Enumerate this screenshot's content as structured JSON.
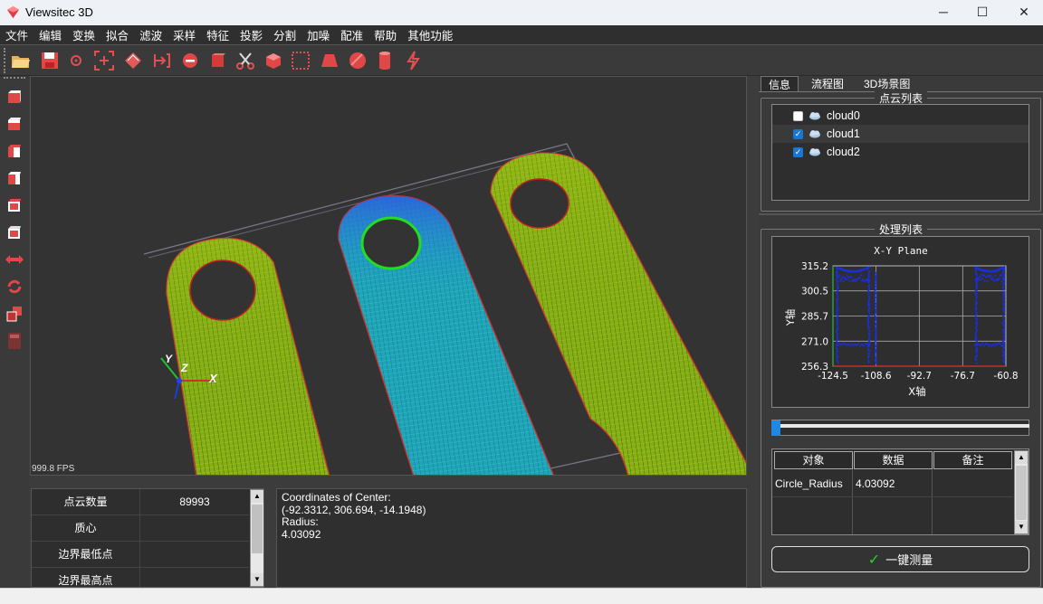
{
  "window": {
    "title": "Viewsitec 3D",
    "minimize_icon": "─",
    "maximize_icon": "☐",
    "close_icon": "✕"
  },
  "menu": [
    "文件",
    "编辑",
    "变换",
    "拟合",
    "滤波",
    "采样",
    "特征",
    "投影",
    "分割",
    "加噪",
    "配准",
    "帮助",
    "其他功能"
  ],
  "toolbar_icons": [
    "open-folder-icon",
    "save-icon",
    "point-icon",
    "select-point-icon",
    "fit-plane-icon",
    "measure-icon",
    "circle-minus-icon",
    "cube-red-icon",
    "scissors-icon",
    "box-icon",
    "box-select-icon",
    "frustum-icon",
    "sphere-icon",
    "cylinder-icon",
    "lightning-icon"
  ],
  "left_toolbar_icons": [
    "view-front-icon",
    "view-back-icon",
    "view-left-icon",
    "view-right-icon",
    "view-top-icon",
    "view-bottom-icon",
    "translate-arrows-icon",
    "rotate-icon",
    "scale-icon",
    "calculator-icon"
  ],
  "viewport": {
    "fps": "999.8 FPS",
    "axis_x": "X",
    "axis_y": "Y",
    "axis_z": "Z"
  },
  "properties": {
    "rows": [
      {
        "key": "点云数量",
        "value": "89993"
      },
      {
        "key": "质心",
        "value": ""
      },
      {
        "key": "边界最低点",
        "value": ""
      },
      {
        "key": "边界最高点",
        "value": ""
      }
    ]
  },
  "coords_panel": {
    "line1": "Coordinates of Center:",
    "line2": "(-92.3312, 306.694, -14.1948)",
    "line3": "Radius:",
    "line4": "4.03092"
  },
  "right_tabs": [
    "信息",
    "流程图",
    "3D场景图"
  ],
  "cloud_list": {
    "title": "点云列表",
    "items": [
      {
        "label": "cloud0",
        "checked": false
      },
      {
        "label": "cloud1",
        "checked": true
      },
      {
        "label": "cloud2",
        "checked": true
      }
    ]
  },
  "process_list": {
    "title": "处理列表"
  },
  "chart_data": {
    "type": "scatter",
    "title": "X-Y Plane",
    "xlabel": "X轴",
    "ylabel": "Y轴",
    "xticks": [
      "-124.5",
      "-108.6",
      "-92.7",
      "-76.7",
      "-60.8"
    ],
    "yticks": [
      "315.2",
      "300.5",
      "285.7",
      "271.0",
      "256.3"
    ],
    "xlim": [
      -124.5,
      -60.8
    ],
    "ylim": [
      256.3,
      315.2
    ],
    "grid": true,
    "series_color": "#1a2fe0"
  },
  "data_table": {
    "headers": [
      "对象",
      "数据",
      "备注"
    ],
    "rows": [
      [
        "Circle_Radius",
        "4.03092",
        ""
      ]
    ]
  },
  "measure_button": {
    "label": "一键测量",
    "icon": "✓"
  },
  "colors": {
    "accent_blue": "#1976d2",
    "check_green": "#2fcf2f"
  }
}
